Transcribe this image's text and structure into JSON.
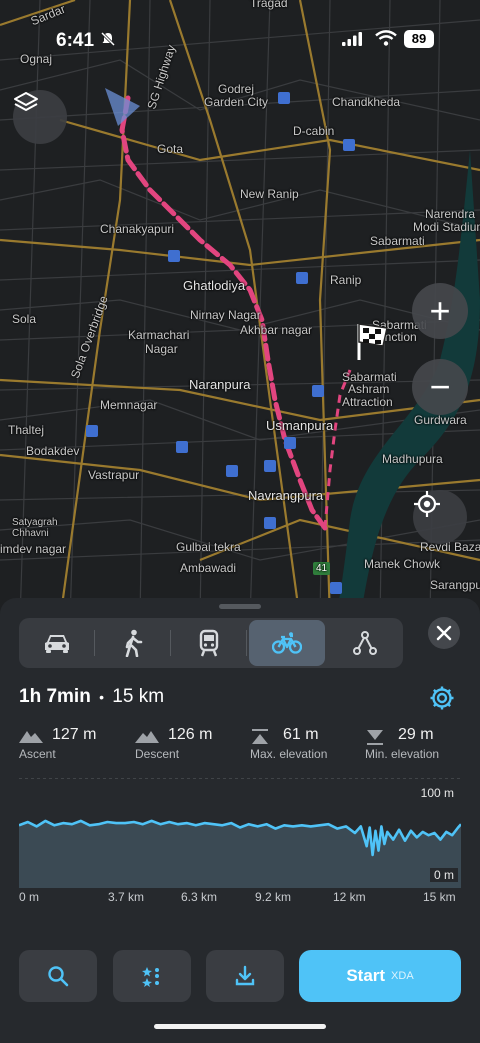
{
  "status_bar": {
    "time": "6:41",
    "battery": "89"
  },
  "map": {
    "labels": [
      "Sardar",
      "Ognaj",
      "SG Highway",
      "Tragad",
      "Godrej",
      "Garden City",
      "Chandkheda",
      "D-cabin",
      "Gota",
      "New Ranip",
      "Narendra",
      "Modi Stadium",
      "Chanakyapuri",
      "Sabarmati",
      "Ghatlodiya",
      "Ranip",
      "Sola Overbridge",
      "Sola",
      "Nirnay Nagar",
      "Akhbar nagar",
      "Sabarmati",
      "Junction",
      "Karmachari",
      "Nagar",
      "Naranpura",
      "Sabarmati",
      "Ashram",
      "Attraction",
      "Memnagar",
      "Usmanpura",
      "Gurdwara",
      "Thaltej",
      "Bodakdev",
      "Madhupura",
      "Vastrapur",
      "Navrangpura",
      "Satyagrah",
      "Chhavni",
      "Gulbai tekra",
      "Revdi Bazar",
      "imdev nagar",
      "Ambawadi",
      "Manek Chowk",
      "Sarangpur",
      "41"
    ],
    "zoom_in": "+",
    "zoom_out": "−",
    "layers_icon": "layers-icon",
    "locate_icon": "crosshair-icon",
    "route_color": "#e2457f"
  },
  "sheet": {
    "modes": [
      {
        "name": "car",
        "icon": "car-icon",
        "active": false
      },
      {
        "name": "walk",
        "icon": "walk-icon",
        "active": false
      },
      {
        "name": "transit",
        "icon": "train-icon",
        "active": false
      },
      {
        "name": "bike",
        "icon": "bicycle-icon",
        "active": true
      },
      {
        "name": "route",
        "icon": "waypoints-icon",
        "active": false
      }
    ],
    "close_icon": "close-icon",
    "duration": "1h 7min",
    "separator": "•",
    "distance": "15 km",
    "stats": [
      {
        "value": "127 m",
        "label": "Ascent",
        "icon": "ascent-icon"
      },
      {
        "value": "126 m",
        "label": "Descent",
        "icon": "descent-icon"
      },
      {
        "value": "61 m",
        "label": "Max. elevation",
        "icon": "max-elevation-icon"
      },
      {
        "value": "29 m",
        "label": "Min. elevation",
        "icon": "min-elevation-icon"
      }
    ],
    "accent": "#4fc3f7",
    "start_label": "Start",
    "watermark": "XDA"
  },
  "chart_data": {
    "type": "area",
    "x_ticks": [
      "0 m",
      "3.7 km",
      "6.3 km",
      "9.2 km",
      "12 km",
      "15 km"
    ],
    "y_ticks": [
      "100 m",
      "0 m"
    ],
    "ylim": [
      0,
      100
    ],
    "xlim_km": [
      0,
      15
    ],
    "series": [
      {
        "x": [
          0,
          0.3,
          0.6,
          0.9,
          1.2,
          1.5,
          1.8,
          2.1,
          2.4,
          2.7,
          3.0,
          3.3,
          3.6,
          3.9,
          4.2,
          4.5,
          4.8,
          5.1,
          5.4,
          5.7,
          6.0,
          6.3,
          6.6,
          6.9,
          7.2,
          7.5,
          7.8,
          8.1,
          8.4,
          8.7,
          9.0,
          9.3,
          9.6,
          9.9,
          10.2,
          10.5,
          10.8,
          11.1,
          11.4,
          11.6,
          11.8,
          11.9,
          12.0,
          12.1,
          12.2,
          12.3,
          12.4,
          12.5,
          12.7,
          12.9,
          13.1,
          13.3,
          13.5,
          13.7,
          13.9,
          14.1,
          14.3,
          14.5,
          14.7,
          14.9,
          15.0
        ],
        "y": [
          57,
          60,
          56,
          61,
          57,
          59,
          58,
          61,
          57,
          58,
          60,
          59,
          59,
          60,
          58,
          61,
          58,
          60,
          58,
          59,
          57,
          59,
          58,
          57,
          59,
          55,
          58,
          56,
          58,
          54,
          57,
          56,
          57,
          56,
          57,
          58,
          54,
          56,
          50,
          56,
          38,
          55,
          30,
          52,
          34,
          56,
          40,
          51,
          44,
          53,
          43,
          52,
          46,
          51,
          48,
          50,
          44,
          51,
          48,
          55,
          58
        ]
      }
    ]
  }
}
